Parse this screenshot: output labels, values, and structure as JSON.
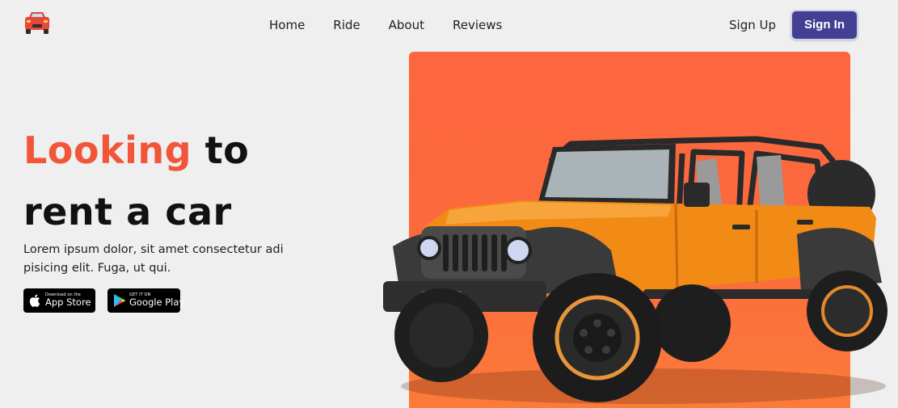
{
  "nav": {
    "logo_icon": "car-icon",
    "links": [
      "Home",
      "Ride",
      "About",
      "Reviews"
    ],
    "signup_label": "Sign Up",
    "signin_label": "Sign In"
  },
  "hero": {
    "headline_accent": "Looking",
    "headline_rest": " to",
    "headline_line2": "rent a car",
    "description": "Lorem ipsum dolor, sit amet consectetur adi pisicing elit. Fuga, ut qui.",
    "app_store": {
      "small": "Download on the",
      "big": "App Store",
      "icon": "apple-icon"
    },
    "google_play": {
      "small": "GET IT ON",
      "big": "Google Play",
      "icon": "google-play-icon"
    },
    "image": "orange-jeep-image"
  },
  "colors": {
    "accent": "#f1563a",
    "primary_button": "#434094",
    "panel": "#fe6640",
    "background": "#efefef"
  }
}
